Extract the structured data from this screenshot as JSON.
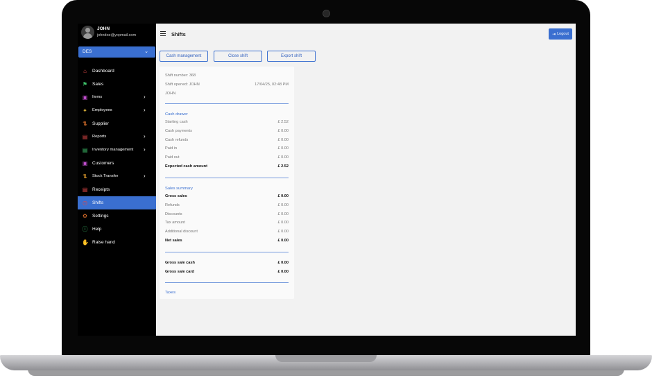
{
  "user": {
    "name": "JOHN",
    "email": "johndoe@yopmail.com"
  },
  "store": {
    "selected": "DES"
  },
  "sidebar": {
    "items": [
      {
        "label": "Dashboard",
        "icon": "home-icon",
        "color": "#e54848",
        "arrow": false
      },
      {
        "label": "Sales",
        "icon": "bell-icon",
        "color": "#3fc36b",
        "arrow": false
      },
      {
        "label": "Items",
        "icon": "basket-icon",
        "color": "#c34fd0",
        "arrow": true
      },
      {
        "label": "Employees",
        "icon": "person-icon",
        "color": "#e0b63b",
        "arrow": true
      },
      {
        "label": "Supplier",
        "icon": "swap-icon",
        "color": "#f07a2f",
        "arrow": false
      },
      {
        "label": "Reports",
        "icon": "report-icon",
        "color": "#e54848",
        "arrow": true
      },
      {
        "label": "Inventory management",
        "icon": "cart-icon",
        "color": "#3fc36b",
        "arrow": true
      },
      {
        "label": "Customers",
        "icon": "customer-icon",
        "color": "#c34fd0",
        "arrow": false
      },
      {
        "label": "Stock Transfer",
        "icon": "transfer-icon",
        "color": "#f0a62f",
        "arrow": true
      },
      {
        "label": "Receipts",
        "icon": "receipt-icon",
        "color": "#e54848",
        "arrow": false
      },
      {
        "label": "Shifts",
        "icon": "clock-icon",
        "color": "#e54848",
        "arrow": false,
        "active": true
      },
      {
        "label": "Settings",
        "icon": "gear-icon",
        "color": "#f07a2f",
        "arrow": false
      },
      {
        "label": "Help",
        "icon": "help-icon",
        "color": "#3fc36b",
        "arrow": false
      },
      {
        "label": "Raise hand",
        "icon": "hand-icon",
        "color": "#c34fd0",
        "arrow": false
      }
    ]
  },
  "header": {
    "title": "Shifts",
    "logout_label": "Logout"
  },
  "actions": {
    "cash_management": "Cash management",
    "close_shift": "Close shift",
    "export_shift": "Export shift"
  },
  "shift": {
    "number": "Shift number: 368",
    "opened": "Shift opened: JOHN",
    "opened_time": "17/04/25, 02:48 PM",
    "opener": "JOHN",
    "cash_drawer": {
      "title": "Cash drawer",
      "rows": [
        {
          "label": "Starting cash",
          "value": "£ 2.52"
        },
        {
          "label": "Cash payments",
          "value": "£ 0.00"
        },
        {
          "label": "Cash refunds",
          "value": "£ 0.00"
        },
        {
          "label": "Paid in",
          "value": "£ 0.00"
        },
        {
          "label": "Paid out",
          "value": "£ 0.00"
        },
        {
          "label": "Expected cash amount",
          "value": "£ 2.52"
        }
      ]
    },
    "sales_summary": {
      "title": "Sales summary",
      "rows": [
        {
          "label": "Gross sales",
          "value": "£ 0.00"
        },
        {
          "label": "Refunds",
          "value": "£ 0.00"
        },
        {
          "label": "Discounts",
          "value": "£ 0.00"
        },
        {
          "label": "Tax amount",
          "value": "£ 0.00"
        },
        {
          "label": "Additional discount",
          "value": "£ 0.00"
        },
        {
          "label": "Net sales",
          "value": "£ 0.00"
        }
      ]
    },
    "payments": {
      "rows": [
        {
          "label": "Gross sale cash",
          "value": "£ 0.00"
        },
        {
          "label": "Gross sale card",
          "value": "£ 0.00"
        }
      ]
    },
    "taxes": {
      "title": "Taxes"
    }
  }
}
